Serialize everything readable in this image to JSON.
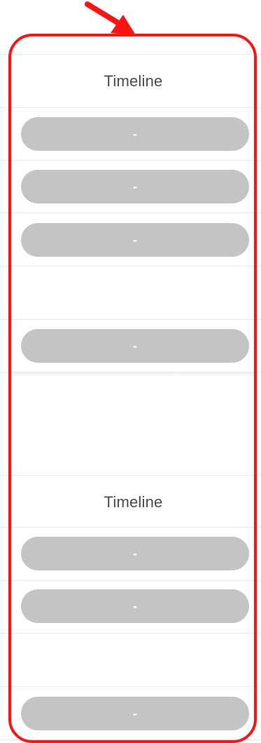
{
  "timeline_column": {
    "sections": [
      {
        "header": "Timeline",
        "rows": [
          {
            "value": "-"
          },
          {
            "value": "-"
          },
          {
            "value": "-"
          },
          {
            "value": null
          },
          {
            "value": "-"
          }
        ]
      },
      {
        "header": "Timeline",
        "rows": [
          {
            "value": "-"
          },
          {
            "value": "-"
          },
          {
            "value": null
          },
          {
            "value": "-"
          }
        ]
      }
    ]
  },
  "annotation": {
    "highlight_color": "#ff1212",
    "pointer_icon": "red-arrow-icon"
  },
  "colors": {
    "pill_empty": "#c4c4c4",
    "divider": "#e7e7ef",
    "header_text": "#4a4a52"
  }
}
